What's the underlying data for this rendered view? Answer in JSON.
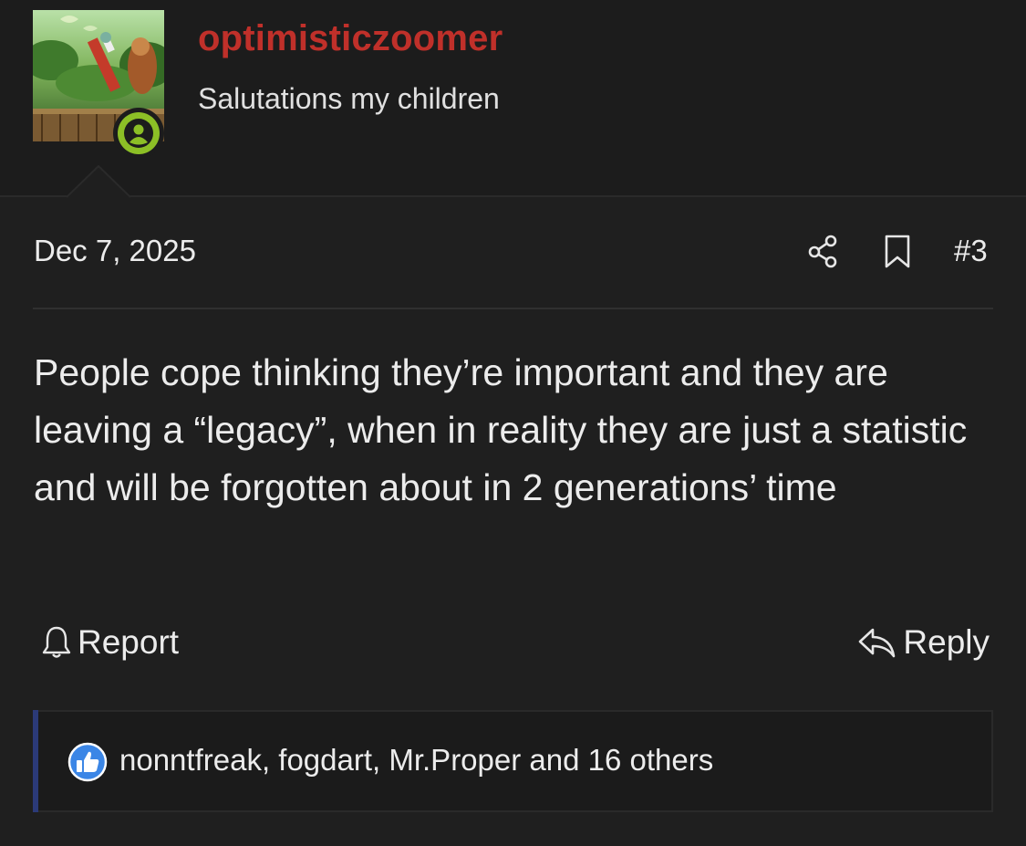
{
  "user": {
    "username": "optimisticzoomer",
    "title": "Salutations my children",
    "status": "online",
    "username_color": "#c0302a",
    "status_color": "#8cbf26"
  },
  "post": {
    "date": "Dec 7, 2025",
    "number": "#3",
    "body": "People cope thinking they’re important and they are leaving a “legacy”, when in reality they are just a statistic and will be forgotten about in 2 generations’ time"
  },
  "actions": {
    "report_label": "Report",
    "reply_label": "Reply"
  },
  "icons": {
    "share": "share-icon",
    "bookmark": "bookmark-icon",
    "report": "bell-icon",
    "reply": "reply-arrow-icon",
    "like": "thumbs-up-icon",
    "status": "user-icon"
  },
  "reactions": {
    "text": "nonntfreak, fogdart, Mr.Proper and 16 others",
    "accent_color": "#2b3a78"
  }
}
